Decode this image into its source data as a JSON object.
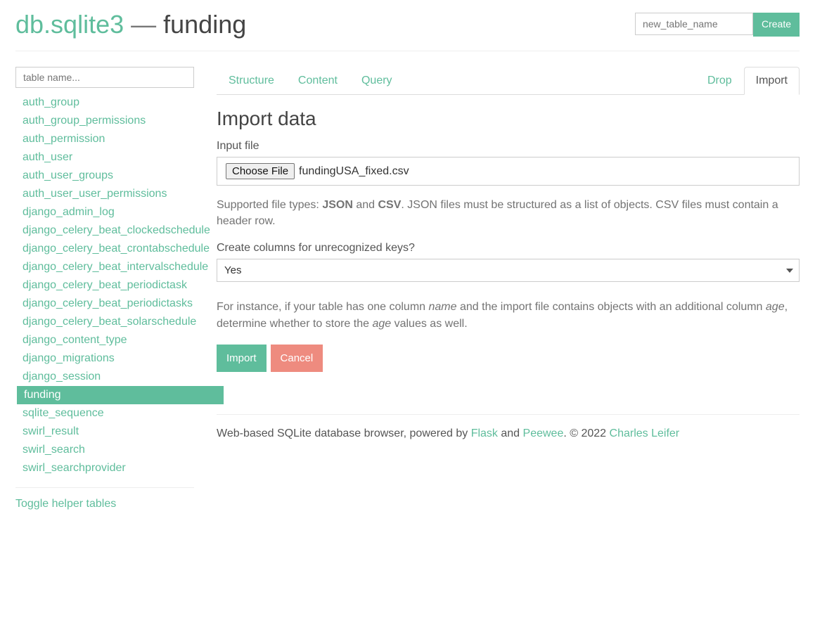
{
  "header": {
    "db_name": "db.sqlite3",
    "separator": " — ",
    "table_name": "funding",
    "new_table_placeholder": "new_table_name",
    "create_label": "Create"
  },
  "sidebar": {
    "filter_placeholder": "table name...",
    "tables": [
      "auth_group",
      "auth_group_permissions",
      "auth_permission",
      "auth_user",
      "auth_user_groups",
      "auth_user_user_permissions",
      "django_admin_log",
      "django_celery_beat_clockedschedule",
      "django_celery_beat_crontabschedule",
      "django_celery_beat_intervalschedule",
      "django_celery_beat_periodictask",
      "django_celery_beat_periodictasks",
      "django_celery_beat_solarschedule",
      "django_content_type",
      "django_migrations",
      "django_session",
      "funding",
      "sqlite_sequence",
      "swirl_result",
      "swirl_search",
      "swirl_searchprovider"
    ],
    "active_index": 16,
    "toggle_label": "Toggle helper tables"
  },
  "tabs": {
    "structure": "Structure",
    "content": "Content",
    "query": "Query",
    "drop": "Drop",
    "import": "Import"
  },
  "import": {
    "heading": "Import data",
    "input_file_label": "Input file",
    "choose_file_label": "Choose File",
    "selected_file": "fundingUSA_fixed.csv",
    "file_help_prefix": "Supported file types: ",
    "file_help_json": "JSON",
    "file_help_and": " and ",
    "file_help_csv": "CSV",
    "file_help_suffix": ". JSON files must be structured as a list of objects. CSV files must contain a header row.",
    "create_cols_label": "Create columns for unrecognized keys?",
    "create_cols_value": "Yes",
    "cols_help_a": "For instance, if your table has one column ",
    "cols_help_name": "name",
    "cols_help_b": " and the import file contains objects with an additional column ",
    "cols_help_age1": "age",
    "cols_help_c": ", determine whether to store the ",
    "cols_help_age2": "age",
    "cols_help_d": " values as well.",
    "submit_label": "Import",
    "cancel_label": "Cancel"
  },
  "footer": {
    "prefix": "Web-based SQLite database browser, powered by ",
    "flask": "Flask",
    "and": " and ",
    "peewee": "Peewee",
    "copyright": ". © 2022 ",
    "author": "Charles Leifer"
  }
}
